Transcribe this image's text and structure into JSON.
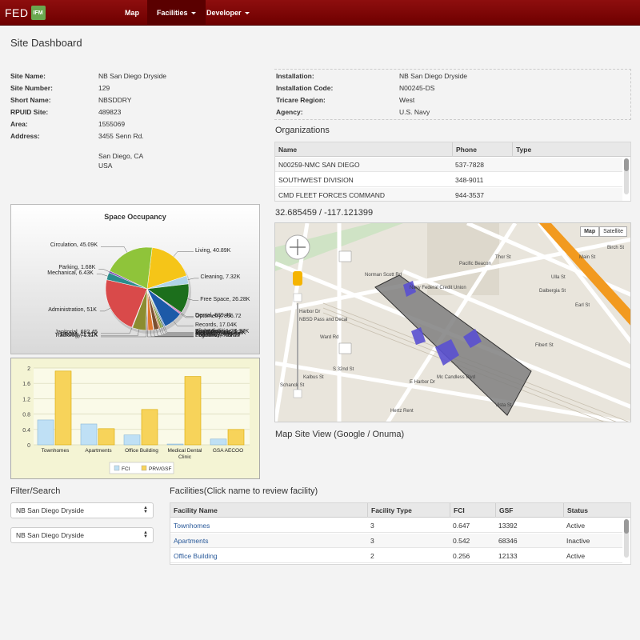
{
  "nav": {
    "brand": "FED",
    "brand_badge": "IFM",
    "items": [
      {
        "label": "Map"
      },
      {
        "label": "Facilities"
      },
      {
        "label": "Developer"
      }
    ]
  },
  "page_title": "Site Dashboard",
  "site_info": [
    {
      "label": "Site Name:",
      "value": "NB San Diego Dryside"
    },
    {
      "label": "Site Number:",
      "value": "129"
    },
    {
      "label": "Short Name:",
      "value": "NBSDDRY"
    },
    {
      "label": "RPUID Site:",
      "value": "489823"
    },
    {
      "label": "Area:",
      "value": "1555069"
    },
    {
      "label": "Address:",
      "value": "3455 Senn Rd."
    }
  ],
  "address_city": "San Diego, CA",
  "address_country": "USA",
  "install_info": [
    {
      "label": "Installation:",
      "value": "NB San Diego Dryside"
    },
    {
      "label": "Installation Code:",
      "value": "N00245-DS"
    },
    {
      "label": "Tricare Region:",
      "value": "West"
    },
    {
      "label": "Agency:",
      "value": "U.S. Navy"
    }
  ],
  "organizations": {
    "title": "Organizations",
    "columns": [
      "Name",
      "Phone",
      "Type"
    ],
    "rows": [
      [
        "N00259-NMC SAN DIEGO",
        "537-7828",
        ""
      ],
      [
        "SOUTHWEST DIVISION",
        "348-9011",
        ""
      ],
      [
        "CMD FLEET FORCES COMMAND",
        "944-3537",
        ""
      ]
    ]
  },
  "coordinates": "32.685459 / -117.121399",
  "map": {
    "buttons": [
      "Map",
      "Satellite"
    ],
    "caption": "Map Site View (Google / Onuma)",
    "labels": [
      "Main St",
      "Norman Scott Rd",
      "Pacific Beacon",
      "Navy Federal Credit Union",
      "E Harbor Dr",
      "Harbor Dr",
      "S 32nd St",
      "Hertz Rent",
      "NBSD Pass and Decal",
      "Mc Candless Blvd",
      "Thor St",
      "Dalbergia St",
      "Birch St",
      "Fibert St",
      "Vista St",
      "Ward Rd",
      "Kalbus St",
      "Schanck St",
      "Earl St",
      "Ulla St"
    ]
  },
  "pie_chart": {
    "title": "Space Occupancy",
    "slices": [
      {
        "label": "Living, 40.89K",
        "value": 40890,
        "color": "#f5c518"
      },
      {
        "label": "Cleaning, 7.32K",
        "value": 7320,
        "color": "#b0d4e8"
      },
      {
        "label": "Free Space, 26.28K",
        "value": 26280,
        "color": "#1c6f1c"
      },
      {
        "label": "Dental, 839.41",
        "value": 839.41,
        "color": "#9c3b9c"
      },
      {
        "label": "Optometry, 856.72",
        "value": 856.72,
        "color": "#c64e9c"
      },
      {
        "label": "Records, 17.04K",
        "value": 17040,
        "color": "#1d5aa8"
      },
      {
        "label": "FlightMedicine, 1.27K",
        "value": 1270,
        "color": "#6a8fcc"
      },
      {
        "label": "Biomedical, 1.2K",
        "value": 1200,
        "color": "#4a6c2a"
      },
      {
        "label": "AdultMedicine, 2.2K",
        "value": 2200,
        "color": "#88a048"
      },
      {
        "label": "MentalHealth, 1.13K",
        "value": 1130,
        "color": "#c06a30"
      },
      {
        "label": "Pathology, 4.43K",
        "value": 4430,
        "color": "#7c5030"
      },
      {
        "label": "Pharmacy, 495.08",
        "value": 495.08,
        "color": "#d48a8a"
      },
      {
        "label": "Logistics, 4.75K",
        "value": 4750,
        "color": "#e07830"
      },
      {
        "label": "Pediatrics, 792.12",
        "value": 792.12,
        "color": "#a03030"
      },
      {
        "label": "Radiology, 1.11K",
        "value": 1110,
        "color": "#5a5a5a"
      },
      {
        "label": "EROM, 11.91K",
        "value": 11910,
        "color": "#8c8c30"
      },
      {
        "label": "Janitorial, 692.45",
        "value": 692.45,
        "color": "#d0a0d0"
      },
      {
        "label": "Administration, 51K",
        "value": 51000,
        "color": "#d94a4a"
      },
      {
        "label": "Mechanical, 6.43K",
        "value": 6430,
        "color": "#2a8c8c"
      },
      {
        "label": "Parking, 1.68K",
        "value": 1680,
        "color": "#7e4fb0"
      },
      {
        "label": "Circulation, 45.09K",
        "value": 45090,
        "color": "#8fc43a"
      }
    ]
  },
  "chart_data": {
    "type": "bar",
    "categories": [
      "Townhomes",
      "Apartments",
      "Office Building",
      "Medical Dental Clinic",
      "GSA AECOO"
    ],
    "series": [
      {
        "name": "FCI",
        "values": [
          0.647,
          0.542,
          0.256,
          0.02,
          0.15
        ],
        "color": "#bfe0f5"
      },
      {
        "name": "PRV/GSF",
        "values": [
          1.92,
          0.42,
          0.92,
          1.78,
          0.4
        ],
        "color": "#f7d35a"
      }
    ],
    "yticks": [
      "0",
      "0.4",
      "0.8",
      "1.2",
      "1.6",
      "2"
    ],
    "ylim": [
      0,
      2
    ],
    "legend_position": "bottom"
  },
  "filter": {
    "title": "Filter/Search",
    "select1": "NB San Diego Dryside",
    "select2": "NB San Diego Dryside"
  },
  "facilities": {
    "title": "Facilities(Click name to review facility)",
    "columns": [
      "Facility Name",
      "Facility Type",
      "FCI",
      "GSF",
      "Status"
    ],
    "rows": [
      [
        "Townhomes",
        "3",
        "0.647",
        "13392",
        "Active"
      ],
      [
        "Apartments",
        "3",
        "0.542",
        "68346",
        "Inactive"
      ],
      [
        "Office Building",
        "2",
        "0.256",
        "12133",
        "Active"
      ]
    ]
  }
}
